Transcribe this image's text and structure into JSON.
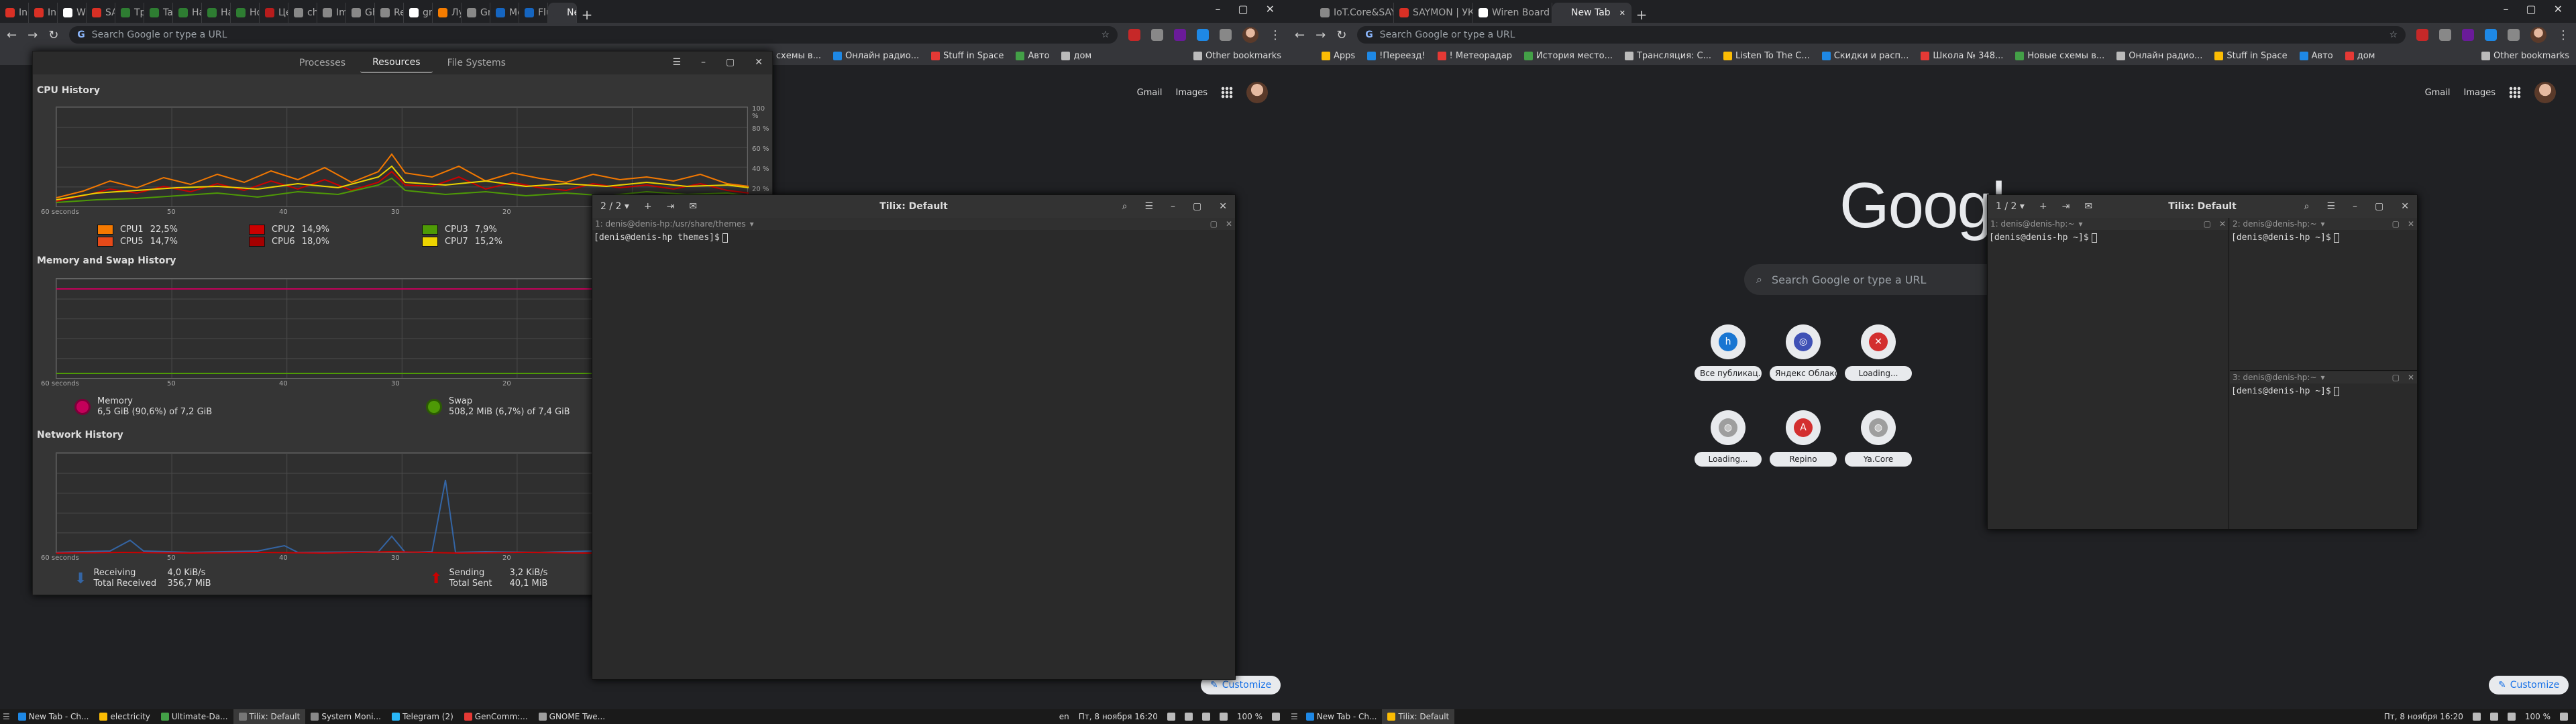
{
  "left_browser": {
    "tabs": [
      {
        "label": "Inb",
        "color": "#d93025"
      },
      {
        "label": "Inb",
        "color": "#d93025"
      },
      {
        "label": "Wi",
        "color": "#ffffff"
      },
      {
        "label": "SA",
        "color": "#d93025"
      },
      {
        "label": "Tp",
        "color": "#2e7d32"
      },
      {
        "label": "Tal",
        "color": "#2e7d32"
      },
      {
        "label": "Ha",
        "color": "#2e7d32"
      },
      {
        "label": "Ha",
        "color": "#2e7d32"
      },
      {
        "label": "Ho",
        "color": "#2e7d32"
      },
      {
        "label": "Це",
        "color": "#b71c1c"
      },
      {
        "label": "ch",
        "color": "#888888"
      },
      {
        "label": "Im",
        "color": "#888888"
      },
      {
        "label": "Gh",
        "color": "#888888"
      },
      {
        "label": "Re",
        "color": "#888888"
      },
      {
        "label": "gn",
        "color": "#ffffff"
      },
      {
        "label": "Лу",
        "color": "#f57c00"
      },
      {
        "label": "Gn",
        "color": "#888888"
      },
      {
        "label": "Mc",
        "color": "#1565c0"
      },
      {
        "label": "Flu",
        "color": "#1565c0"
      },
      {
        "label": "New T",
        "color": "#35363a",
        "active": true
      }
    ],
    "omnibox_placeholder": "Search Google or type a URL",
    "bookmarks": [
      "ные схемы в...",
      "Онлайн радио...",
      "Stuff in Space",
      "Авто",
      "дом"
    ],
    "other_bookmarks": "Other bookmarks",
    "ntp_links": {
      "gmail": "Gmail",
      "images": "Images"
    },
    "customize": "Customize"
  },
  "right_browser": {
    "tabs": [
      {
        "label": "IoT.Core&SAYMON | tes",
        "color": "#888888"
      },
      {
        "label": "SAYMON | УК / ГПН / Wi",
        "color": "#d93025"
      },
      {
        "label": "Wiren Board Web UI",
        "color": "#ffffff"
      },
      {
        "label": "New Tab",
        "color": "#35363a",
        "active": true
      }
    ],
    "omnibox_placeholder": "Search Google or type a URL",
    "bookmarks": [
      "Apps",
      "!Переезд!",
      "! Метеорадар",
      "История место...",
      "Трансляция: С...",
      "Listen To The C...",
      "Скидки и расп...",
      "Школа № 348...",
      "Новые схемы в...",
      "Онлайн радио...",
      "Stuff in Space",
      "Авто",
      "дом"
    ],
    "other_bookmarks": "Other bookmarks",
    "ntp_links": {
      "gmail": "Gmail",
      "images": "Images"
    },
    "google_logo": "Googl",
    "search_placeholder": "Search Google or type a URL",
    "shortcuts": [
      {
        "label": "Все публикац...",
        "color": "#1976d2",
        "glyph": "h"
      },
      {
        "label": "Яндекс Облако",
        "color": "#3f51b5",
        "glyph": "◎"
      },
      {
        "label": "Loading...",
        "color": "#d32f2f",
        "glyph": "✕"
      },
      {
        "label": "Loading...",
        "color": "#9e9e9e",
        "glyph": "◍"
      },
      {
        "label": "Repino",
        "color": "#d32f2f",
        "glyph": "A"
      },
      {
        "label": "Ya.Core",
        "color": "#9e9e9e",
        "glyph": "◍"
      }
    ],
    "customize": "Customize"
  },
  "system_monitor": {
    "tabs": [
      "Processes",
      "Resources",
      "File Systems"
    ],
    "active_tab": "Resources",
    "cpu_title": "CPU History",
    "memory_title": "Memory and Swap History",
    "network_title": "Network History",
    "x_ticks": [
      "60 seconds",
      "50",
      "40",
      "30",
      "20"
    ],
    "y_ticks": [
      "100 %",
      "80 %",
      "60 %",
      "40 %",
      "20 %"
    ],
    "cpus": [
      {
        "label": "CPU1",
        "value": "22,5%",
        "color": "#f57900"
      },
      {
        "label": "CPU2",
        "value": "14,9%",
        "color": "#cc0000"
      },
      {
        "label": "CPU3",
        "value": "7,9%",
        "color": "#4e9a06"
      },
      {
        "label": "CPU5",
        "value": "14,7%",
        "color": "#e64a19"
      },
      {
        "label": "CPU6",
        "value": "18,0%",
        "color": "#a40000"
      },
      {
        "label": "CPU7",
        "value": "15,2%",
        "color": "#edd400"
      }
    ],
    "memory": {
      "label": "Memory",
      "value": "6,5 GiB (90,6%) of 7,2 GiB"
    },
    "swap": {
      "label": "Swap",
      "value": "508,2 MiB (6,7%) of 7,4 GiB"
    },
    "network": {
      "receiving_label": "Receiving",
      "receiving_value": "4,0 KiB/s",
      "total_received_label": "Total Received",
      "total_received_value": "356,7 MiB",
      "sending_label": "Sending",
      "sending_value": "3,2 KiB/s",
      "total_sent_label": "Total Sent",
      "total_sent_value": "40,1 MiB"
    }
  },
  "tilix_left": {
    "title": "Tilix: Default",
    "session": "2 / 2",
    "pane_title": "1: denis@denis-hp:/usr/share/themes",
    "prompt": "[denis@denis-hp themes]$"
  },
  "tilix_right": {
    "title": "Tilix: Default",
    "session": "1 / 2",
    "panes": [
      {
        "title": "1: denis@denis-hp:~",
        "prompt": "[denis@denis-hp ~]$"
      },
      {
        "title": "2: denis@denis-hp:~",
        "prompt": "[denis@denis-hp ~]$"
      },
      {
        "title": "3: denis@denis-hp:~",
        "prompt": "[denis@denis-hp ~]$"
      }
    ]
  },
  "taskbar_left": {
    "items": [
      "New Tab - Ch...",
      "electricity",
      "Ultimate-Da...",
      "Tilix: Default",
      "System Moni...",
      "Telegram (2)",
      "GenComm:...",
      "GNOME Twe..."
    ],
    "active_index": 3,
    "lang": "en",
    "clock": "Пт, 8 ноября 16:20",
    "zoom": "100 %"
  },
  "taskbar_right": {
    "items": [
      "New Tab - Ch...",
      "Tilix: Default"
    ],
    "clock": "Пт, 8 ноября 16:20",
    "zoom": "100 %"
  }
}
